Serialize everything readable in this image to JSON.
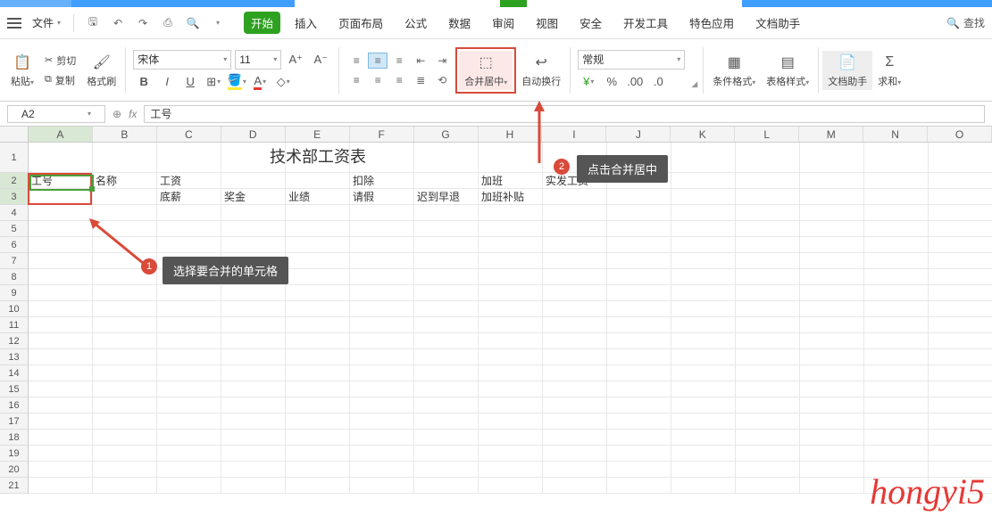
{
  "menu": {
    "file": "文件"
  },
  "tabs": [
    "开始",
    "插入",
    "页面布局",
    "公式",
    "数据",
    "审阅",
    "视图",
    "安全",
    "开发工具",
    "特色应用",
    "文档助手"
  ],
  "search": "查找",
  "clipboard": {
    "paste": "粘贴",
    "cut": "剪切",
    "copy": "复制",
    "painter": "格式刷"
  },
  "font": {
    "name": "宋体",
    "size": "11"
  },
  "merge": {
    "label": "合并居中",
    "wrap": "自动换行"
  },
  "number": {
    "format": "常规"
  },
  "styles": {
    "cond": "条件格式",
    "table": "表格样式"
  },
  "doc": {
    "helper": "文档助手",
    "sum": "求和"
  },
  "namebox": "A2",
  "fx": "工号",
  "columns": [
    "A",
    "B",
    "C",
    "D",
    "E",
    "F",
    "G",
    "H",
    "I",
    "J",
    "K",
    "L",
    "M",
    "N",
    "O"
  ],
  "title": "技术部工资表",
  "headers": {
    "r2": [
      "工号",
      "名称",
      "工资",
      "",
      "",
      "扣除",
      "",
      "加班",
      "实发工资"
    ],
    "r3": [
      "",
      "",
      "底薪",
      "奖金",
      "业绩",
      "请假",
      "迟到早退",
      "加班补贴",
      ""
    ]
  },
  "callouts": {
    "c1": "选择要合并的单元格",
    "c2": "点击合并居中"
  },
  "watermark": "hongyi5"
}
